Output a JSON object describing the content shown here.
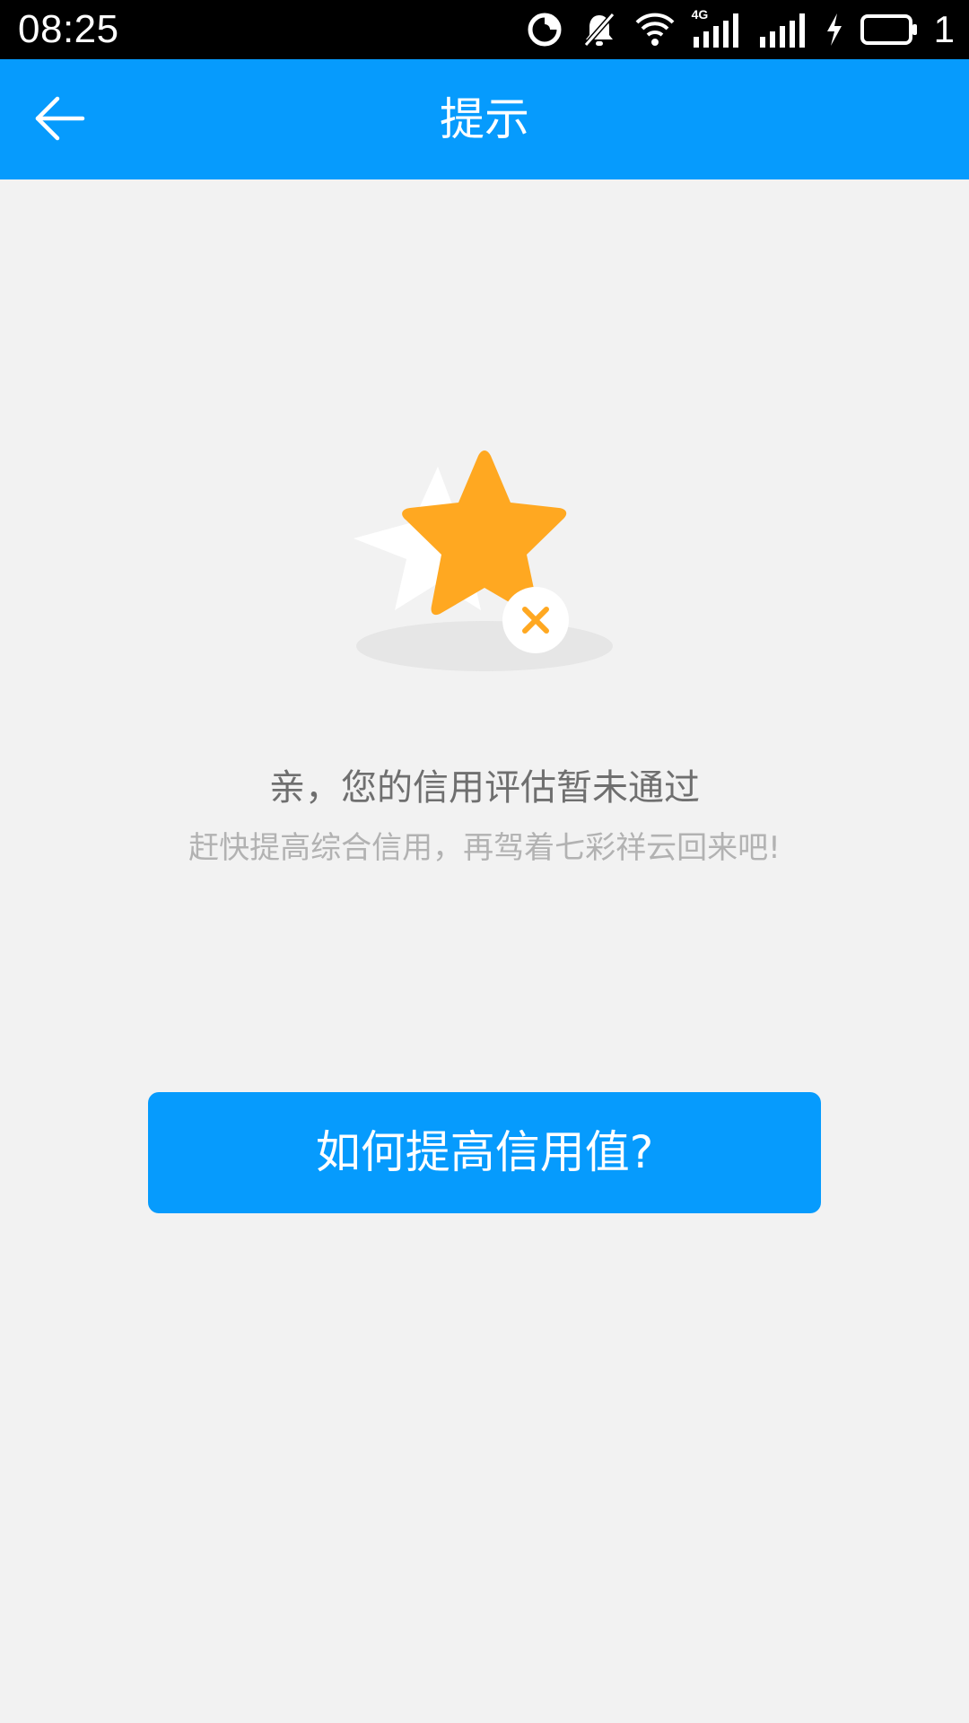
{
  "status_bar": {
    "time": "08:25",
    "network_label": "4G",
    "battery_level": "1",
    "icons": [
      "data-saver-icon",
      "notifications-off-icon",
      "wifi-icon",
      "cellular-4g-signal-icon",
      "cellular-signal-icon",
      "charging-bolt-icon",
      "battery-icon"
    ]
  },
  "app_bar": {
    "title": "提示",
    "back_icon": "arrow-left-icon"
  },
  "illustration": {
    "icon": "star-rejected-icon",
    "star_color": "#ffa821",
    "badge_icon": "close-icon"
  },
  "message": {
    "main": "亲，您的信用评估暂未通过",
    "sub": "赶快提高综合信用，再驾着七彩祥云回来吧!"
  },
  "action": {
    "label": "如何提高信用值?"
  },
  "colors": {
    "primary": "#069bfd",
    "background": "#f2f2f2",
    "accent": "#ffa821"
  }
}
